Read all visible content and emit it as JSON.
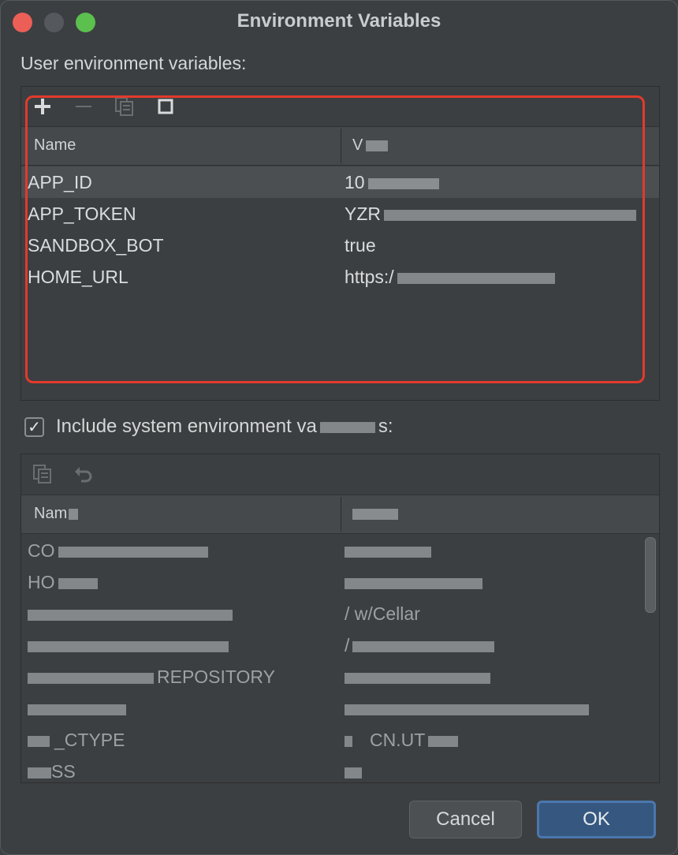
{
  "window": {
    "title": "Environment Variables"
  },
  "user_section": {
    "label": "User environment variables:",
    "toolbar": {
      "add_icon": "plus-icon",
      "remove_icon": "minus-icon",
      "copy_icon": "copy-icon",
      "paste_icon": "square-icon"
    },
    "columns": {
      "name": "Name",
      "value": "V"
    },
    "rows": [
      {
        "name": "APP_ID",
        "value": "10"
      },
      {
        "name": "APP_TOKEN",
        "value": "YZR"
      },
      {
        "name": "SANDBOX_BOT",
        "value": "true"
      },
      {
        "name": "HOME_URL",
        "value": "https:/"
      }
    ]
  },
  "system_section": {
    "checkbox_label": "Include system environment va",
    "checkbox_label_suffix": "s:",
    "checked": true,
    "columns": {
      "name": "Nam",
      "value": ""
    },
    "rows": [
      {
        "name": "CO",
        "value": ""
      },
      {
        "name": "HO",
        "value": ""
      },
      {
        "name": "",
        "value": "/   w/Cellar"
      },
      {
        "name": "",
        "value": "/"
      },
      {
        "name": "REPOSITORY",
        "value": ""
      },
      {
        "name": "",
        "value": ""
      },
      {
        "name": "_CTYPE",
        "value": "CN.UT"
      },
      {
        "name": "SS",
        "value": ""
      }
    ]
  },
  "buttons": {
    "cancel": "Cancel",
    "ok": "OK"
  },
  "colors": {
    "highlight": "#e23a2c",
    "ok_button": "#365880"
  }
}
